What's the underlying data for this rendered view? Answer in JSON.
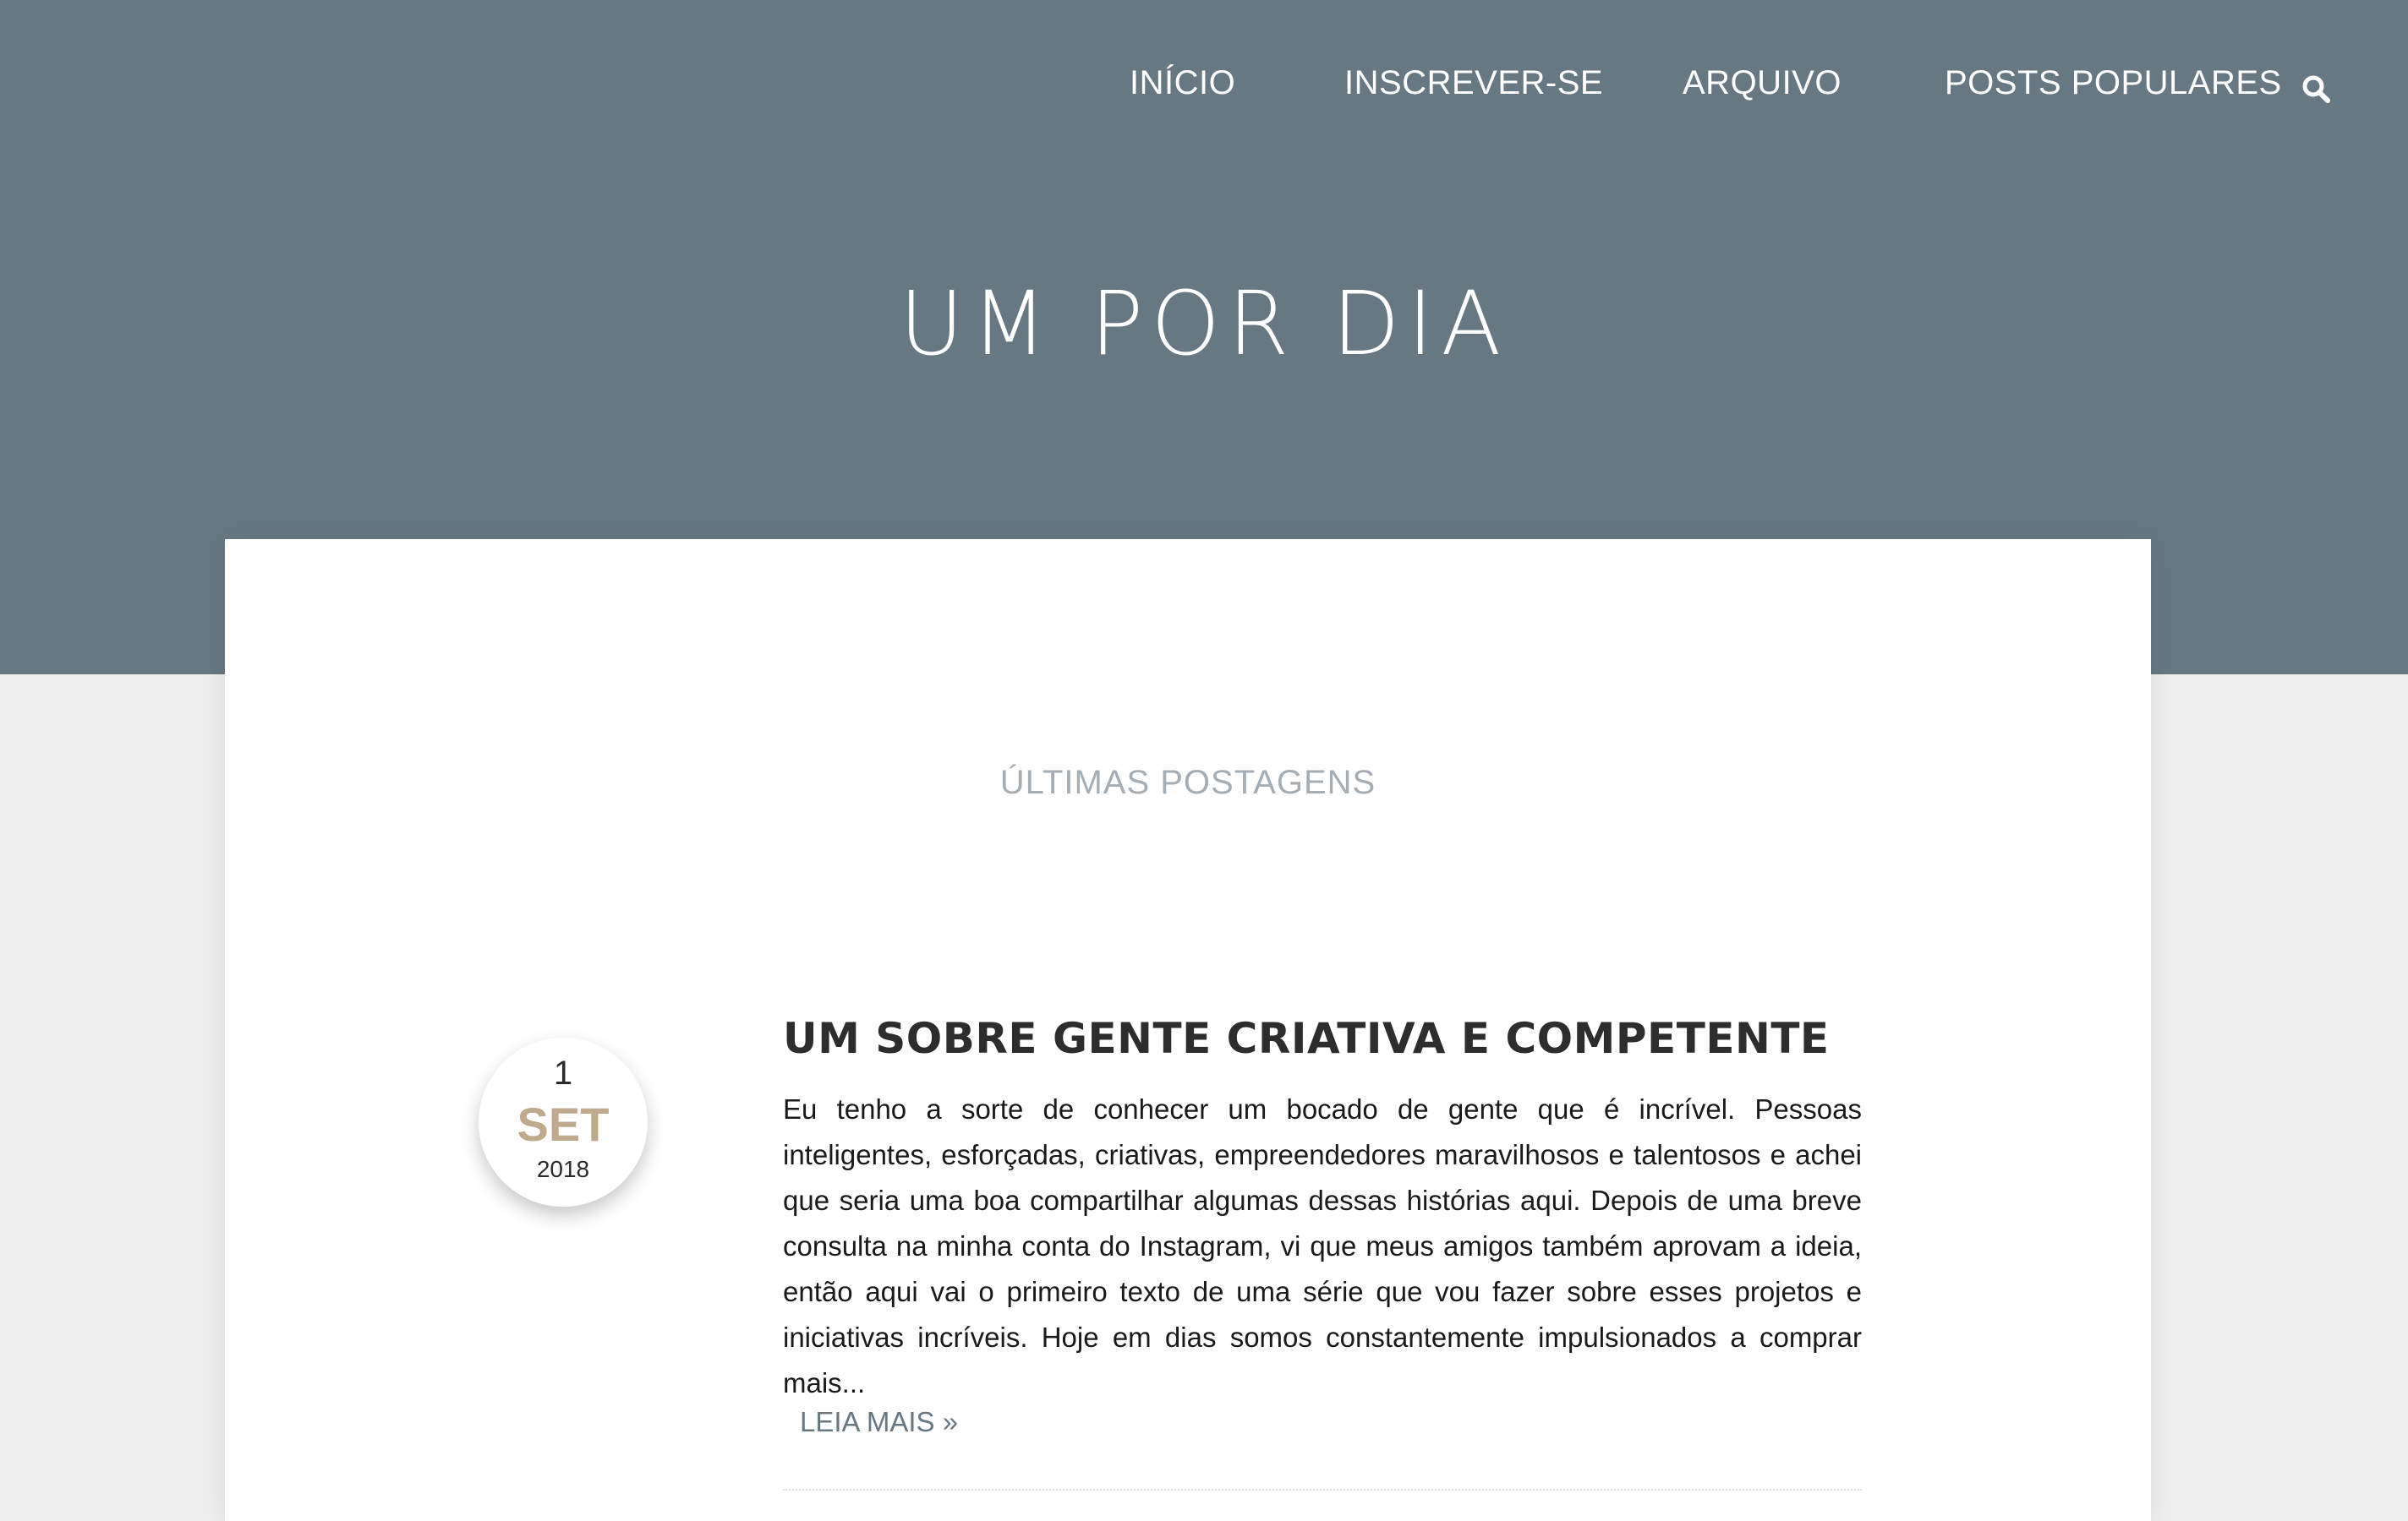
{
  "nav": {
    "items": [
      {
        "label": "INÍCIO"
      },
      {
        "label": "INSCREVER-SE"
      },
      {
        "label": "ARQUIVO"
      },
      {
        "label": "POSTS POPULARES"
      }
    ],
    "search_icon": "search-icon"
  },
  "site": {
    "title": "UM POR DIA"
  },
  "section": {
    "title": "ÚLTIMAS POSTAGENS"
  },
  "post": {
    "date": {
      "day": "1",
      "month": "SET",
      "year": "2018"
    },
    "title": "UM SOBRE GENTE CRIATIVA E COMPETENTE",
    "excerpt": "Eu tenho a sorte de conhecer um bocado de gente que é incrível. Pessoas inteligentes, esforçadas, criativas, empreendedores maravilhosos e talentosos e achei que seria uma boa compartilhar algumas dessas histórias aqui. Depois de uma breve consulta na minha conta do Instagram, vi que meus amigos também aprovam a ideia, então aqui vai o primeiro texto de uma série que vou fazer sobre esses projetos e iniciativas incríveis. Hoje em dias somos constantemente impulsionados a comprar mais...",
    "read_more": "LEIA MAIS »"
  },
  "colors": {
    "header_bg": "#687883",
    "page_bg": "#eeeeee",
    "accent_month": "#c0aa8e",
    "section_title": "#a5adb5"
  }
}
